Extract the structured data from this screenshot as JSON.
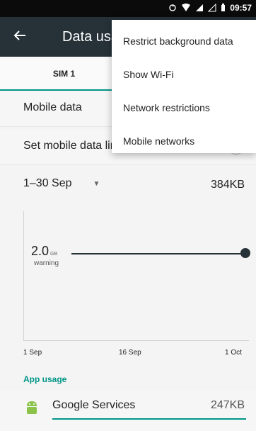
{
  "status": {
    "time": "09:57",
    "icons": [
      "sync-icon",
      "wifi-icon",
      "signal-icon",
      "signal-outline-icon",
      "battery-icon"
    ]
  },
  "appbar": {
    "title": "Data usa",
    "back_icon": "back-arrow-icon"
  },
  "tabs": [
    {
      "label": "SIM 1",
      "active": true
    }
  ],
  "settings": {
    "mobile_data_label": "Mobile data",
    "limit_label": "Set mobile data limit",
    "period": "1–30 Sep",
    "total": "384KB",
    "warning_value": "2.0",
    "warning_unit": "GB",
    "warning_label": "warning",
    "axis": {
      "start": "1 Sep",
      "mid": "16 Sep",
      "end": "1 Oct"
    }
  },
  "app_usage": {
    "title": "App usage",
    "items": [
      {
        "name": "Google Services",
        "size": "247KB",
        "share": 1.0
      }
    ]
  },
  "menu": {
    "items": [
      "Restrict background data",
      "Show Wi-Fi",
      "Network restrictions",
      "Mobile networks"
    ]
  },
  "colors": {
    "appbar": "#263238",
    "accent": "#009688",
    "statusbar": "#0b0b0b",
    "background": "#f4f4f4"
  }
}
